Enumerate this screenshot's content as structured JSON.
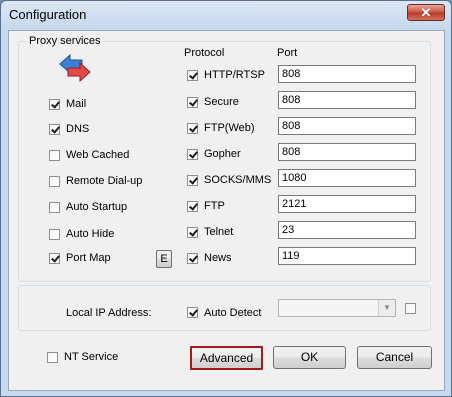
{
  "window": {
    "title": "Configuration",
    "close_symbol": "✕"
  },
  "proxy_group": {
    "title": "Proxy services"
  },
  "headers": {
    "protocol": "Protocol",
    "port": "Port"
  },
  "services": [
    {
      "label": "Mail",
      "checked": true
    },
    {
      "label": "DNS",
      "checked": true
    },
    {
      "label": "Web Cached",
      "checked": false
    },
    {
      "label": "Remote Dial-up",
      "checked": false
    },
    {
      "label": "Auto Startup",
      "checked": false
    },
    {
      "label": "Auto Hide",
      "checked": false
    },
    {
      "label": "Port Map",
      "checked": true
    }
  ],
  "port_map_edit_label": "E",
  "protocols": [
    {
      "label": "HTTP/RTSP",
      "checked": true,
      "port": "808"
    },
    {
      "label": "Secure",
      "checked": true,
      "port": "808"
    },
    {
      "label": "FTP(Web)",
      "checked": true,
      "port": "808"
    },
    {
      "label": "Gopher",
      "checked": true,
      "port": "808"
    },
    {
      "label": "SOCKS/MMS",
      "checked": true,
      "port": "1080"
    },
    {
      "label": "FTP",
      "checked": true,
      "port": "2121"
    },
    {
      "label": "Telnet",
      "checked": true,
      "port": "23"
    },
    {
      "label": "News",
      "checked": true,
      "port": "119"
    }
  ],
  "ip_section": {
    "label": "Local IP Address:",
    "auto_detect_label": "Auto Detect",
    "auto_detect_checked": true,
    "extra_checked": false
  },
  "bottom": {
    "nt_service_label": "NT Service",
    "nt_service_checked": false,
    "advanced_label": "Advanced",
    "ok_label": "OK",
    "cancel_label": "Cancel"
  },
  "icons": {
    "proxy_arrows": "swap-arrows-icon",
    "close": "close-icon"
  },
  "colors": {
    "advanced_border": "#a31a1a",
    "arrow_blue": "#3a7fd8",
    "arrow_red": "#e04a4a"
  }
}
